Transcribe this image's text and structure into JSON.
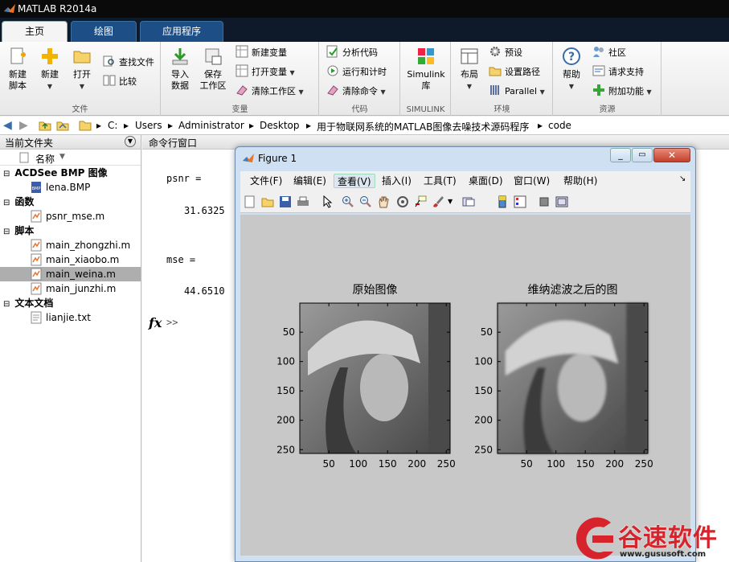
{
  "app": {
    "title": "MATLAB R2014a"
  },
  "tabs": [
    {
      "label": "主页"
    },
    {
      "label": "绘图"
    },
    {
      "label": "应用程序"
    }
  ],
  "ribbon": {
    "file_group": {
      "label": "文件",
      "new_script": "新建\n脚本",
      "new": "新建",
      "open": "打开",
      "find_files": "查找文件",
      "compare": "比较"
    },
    "var_group": {
      "label": "变量",
      "import": "导入\n数据",
      "save": "保存\n工作区",
      "new_var": "新建变量",
      "open_var": "打开变量",
      "clear_ws": "清除工作区"
    },
    "code_group": {
      "label": "代码",
      "analyze": "分析代码",
      "run_time": "运行和计时",
      "clear_cmd": "清除命令"
    },
    "simulink_group": {
      "label": "SIMULINK",
      "simulink": "Simulink\n库"
    },
    "env_group": {
      "label": "环境",
      "layout": "布局",
      "prefs": "预设",
      "set_path": "设置路径",
      "parallel": "Parallel"
    },
    "res_group": {
      "label": "资源",
      "help": "帮助",
      "community": "社区",
      "support": "请求支持",
      "addons": "附加功能"
    }
  },
  "address": {
    "path": [
      "C:",
      "Users",
      "Administrator",
      "Desktop",
      "用于物联网系统的MATLAB图像去噪技术源码程序",
      "code"
    ]
  },
  "current_folder": {
    "title": "当前文件夹",
    "column": "名称",
    "sections": [
      {
        "name": "ACDSee BMP 图像",
        "files": [
          "lena.BMP"
        ]
      },
      {
        "name": "函数",
        "files": [
          "psnr_mse.m"
        ]
      },
      {
        "name": "脚本",
        "files": [
          "main_zhongzhi.m",
          "main_xiaobo.m",
          "main_weina.m",
          "main_junzhi.m"
        ]
      },
      {
        "name": "文本文档",
        "files": [
          "lianjie.txt"
        ]
      }
    ],
    "selected": "main_weina.m"
  },
  "command_window": {
    "title": "命令行窗口",
    "lines": [
      {
        "var": "psnr =",
        "value": "31.6325"
      },
      {
        "var": "mse =",
        "value": "44.6510"
      }
    ],
    "prompt": ">>",
    "fx": "fx"
  },
  "figure": {
    "title": "Figure 1",
    "menu": [
      "文件(F)",
      "编辑(E)",
      "查看(V)",
      "插入(I)",
      "工具(T)",
      "桌面(D)",
      "窗口(W)",
      "帮助(H)"
    ],
    "active_menu": "查看(V)",
    "plots": [
      {
        "title": "原始图像",
        "yticks": [
          "50",
          "100",
          "150",
          "200",
          "250"
        ],
        "xticks": [
          "50",
          "100",
          "150",
          "200",
          "250"
        ]
      },
      {
        "title": "维纳滤波之后的图",
        "yticks": [
          "50",
          "100",
          "150",
          "200",
          "250"
        ],
        "xticks": [
          "50",
          "100",
          "150",
          "200",
          "250"
        ]
      }
    ]
  },
  "watermark": {
    "brand": "谷速软件",
    "url": "www.gususoft.com"
  },
  "colors": {
    "ribbon_tab_blue": "#1d4f86",
    "selected_row": "#aeaeae",
    "figure_bg": "#c8c8c8",
    "watermark_red": "#d7232b"
  }
}
